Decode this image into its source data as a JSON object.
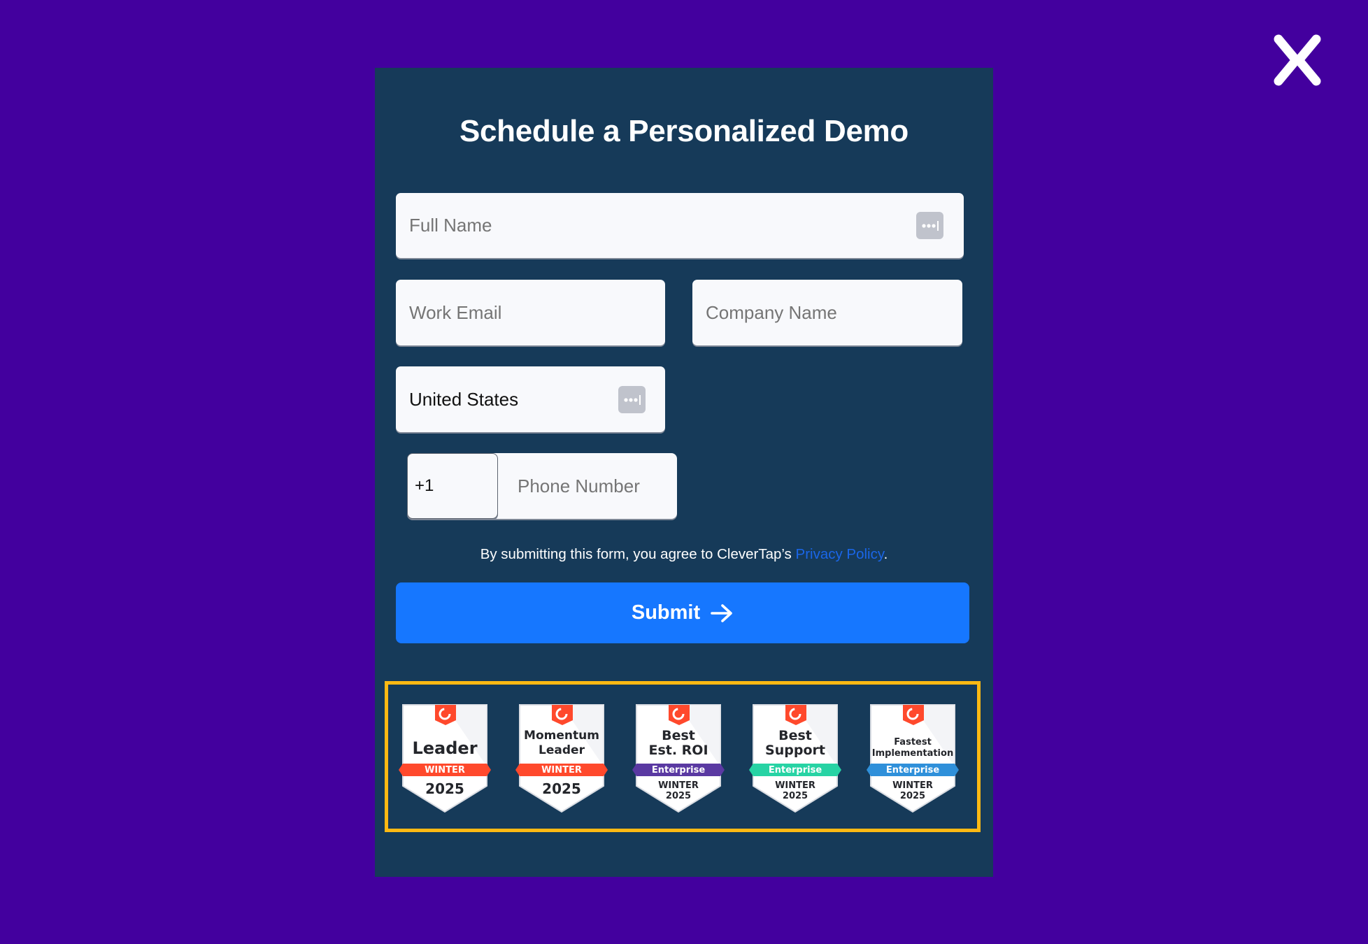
{
  "close_button": {
    "icon": "close-icon",
    "label": "Close"
  },
  "form": {
    "title": "Schedule a Personalized Demo",
    "fields": {
      "full_name": {
        "placeholder": "Full Name",
        "value": ""
      },
      "work_email": {
        "placeholder": "Work Email",
        "value": ""
      },
      "company_name": {
        "placeholder": "Company Name",
        "value": ""
      },
      "country": {
        "value": "United States"
      },
      "phone_code": {
        "value": "+1"
      },
      "phone_number": {
        "placeholder": "Phone Number",
        "value": ""
      }
    },
    "autofill_icon": "password-autofill-icon",
    "consent": {
      "text": "By submitting this form, you agree to CleverTap’s ",
      "link_label": "Privacy Policy",
      "suffix": "."
    },
    "submit_label": "Submit",
    "submit_icon": "arrow-right-icon"
  },
  "badges": [
    {
      "brand": "G2",
      "title_lines": [
        "Leader"
      ],
      "ribbon": "WINTER",
      "footer_lines": [
        "2025"
      ],
      "ribbon_color": "#FF492C"
    },
    {
      "brand": "G2",
      "title_lines": [
        "Momentum",
        "Leader"
      ],
      "ribbon": "WINTER",
      "footer_lines": [
        "2025"
      ],
      "ribbon_color": "#FF492C"
    },
    {
      "brand": "G2",
      "title_lines": [
        "Best",
        "Est. ROI"
      ],
      "ribbon": "Enterprise",
      "footer_lines": [
        "WINTER",
        "2025"
      ],
      "ribbon_color": "#5A39A2"
    },
    {
      "brand": "G2",
      "title_lines": [
        "Best",
        "Support"
      ],
      "ribbon": "Enterprise",
      "footer_lines": [
        "WINTER",
        "2025"
      ],
      "ribbon_color": "#27D3A4"
    },
    {
      "brand": "G2",
      "title_lines": [
        "Fastest",
        "Implementation"
      ],
      "ribbon": "Enterprise",
      "footer_lines": [
        "WINTER",
        "2025"
      ],
      "ribbon_color": "#2F90DA"
    }
  ],
  "colors": {
    "background": "#43009E",
    "panel": "#163A59",
    "submit": "#1677FF",
    "link": "#1A66E8",
    "highlight_border": "#FDB913",
    "g2_red": "#FF492C"
  }
}
